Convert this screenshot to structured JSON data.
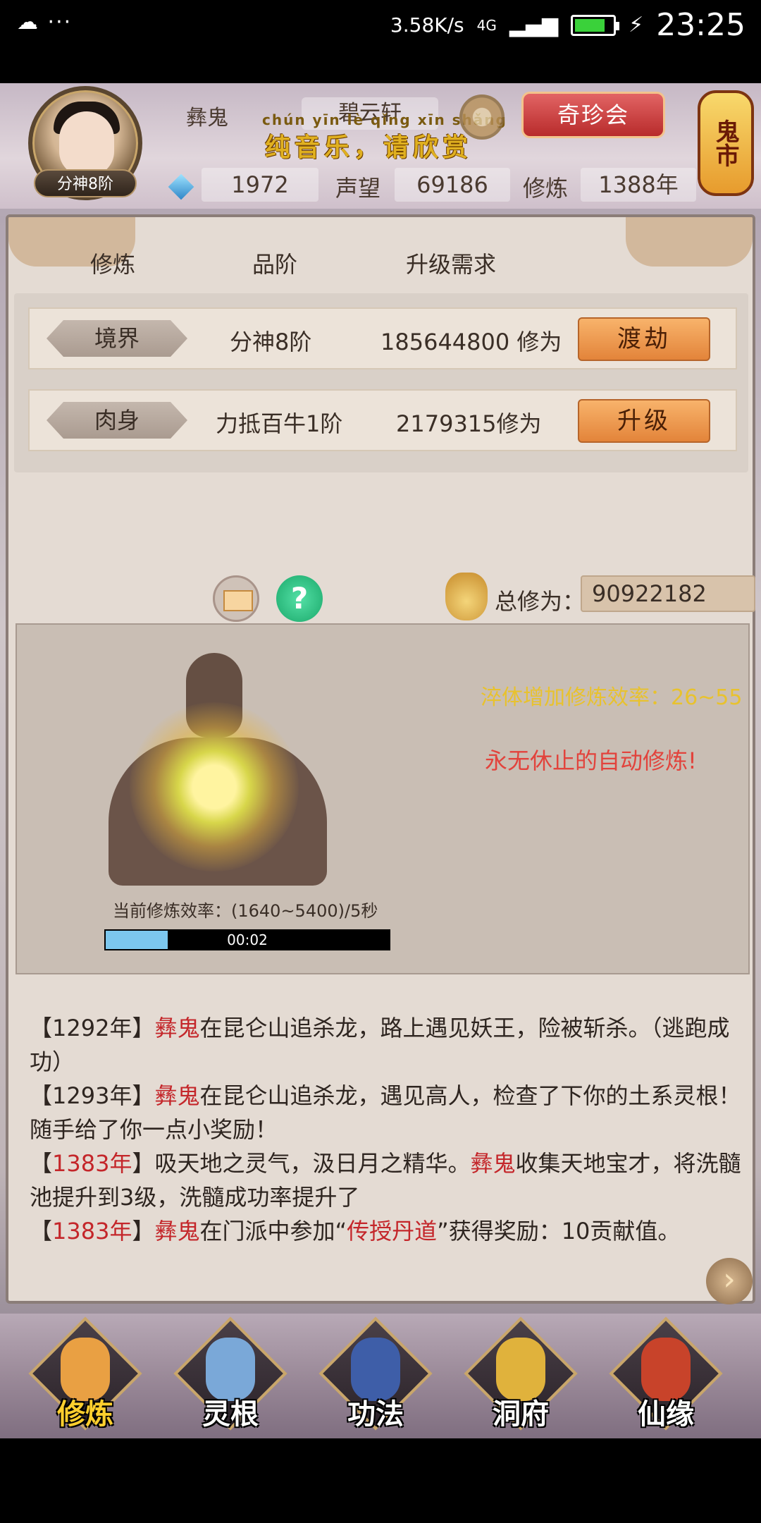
{
  "statusbar": {
    "left": "☁ ···",
    "speed": "3.58K/s",
    "network": "4G",
    "time": "23:25"
  },
  "header": {
    "realm_badge": "分神8阶",
    "player_name": "彝鬼",
    "sect": "碧云轩",
    "music_pinyin": "chún yīn lè  qǐng xīn shǎng",
    "music_text": "纯音乐，请欣赏",
    "treasure_button": "奇珍会",
    "ghost_market": "鬼市",
    "gems": "1972",
    "reputation_label": "声望",
    "reputation": "69186",
    "cultivation_label": "修炼",
    "cultivation_years": "1388年"
  },
  "panel": {
    "columns": [
      "修炼",
      "品阶",
      "升级需求"
    ],
    "rows": [
      {
        "tag": "境界",
        "level": "分神8阶",
        "requirement": "185644800 修为",
        "button": "渡劫"
      },
      {
        "tag": "肉身",
        "level": "力抵百牛1阶",
        "requirement": "2179315修为",
        "button": "升级"
      }
    ],
    "total_label": "总修为：",
    "total_value": "90922182",
    "help_symbol": "?"
  },
  "meditation": {
    "efficiency_bonus": "淬体增加修炼效率：26~55",
    "auto_text": "永无休止的自动修炼!",
    "current_efficiency": "当前修炼效率：(1640~5400)/5秒",
    "timer": "00:02",
    "progress": 0.22
  },
  "log": [
    {
      "year": "1292年",
      "year_red": false,
      "parts": [
        {
          "t": "彝鬼",
          "red": true
        },
        {
          "t": "在昆仑山追杀龙，路上遇见妖王，险被斩杀。（逃跑成功）",
          "red": false
        }
      ]
    },
    {
      "year": "1293年",
      "year_red": false,
      "parts": [
        {
          "t": "彝鬼",
          "red": true
        },
        {
          "t": "在昆仑山追杀龙，遇见高人，检查了下你的土系灵根！随手给了你一点小奖励！",
          "red": false
        }
      ]
    },
    {
      "year": "1383年",
      "year_red": true,
      "parts": [
        {
          "t": "吸天地之灵气，汲日月之精华。",
          "red": false
        },
        {
          "t": "彝鬼",
          "red": true
        },
        {
          "t": "收集天地宝才，将洗髓池提升到3级，洗髓成功率提升了",
          "red": false
        }
      ]
    },
    {
      "year": "1383年",
      "year_red": true,
      "parts": [
        {
          "t": "彝鬼",
          "red": true
        },
        {
          "t": "在门派中参加“",
          "red": false
        },
        {
          "t": "传授丹道",
          "red": true
        },
        {
          "t": "”获得奖励：10贡献值。",
          "red": false
        }
      ]
    }
  ],
  "nav": [
    {
      "label": "修炼",
      "icon": "monk-icon",
      "active": true
    },
    {
      "label": "灵根",
      "icon": "sword-icon",
      "active": false
    },
    {
      "label": "功法",
      "icon": "book-icon",
      "active": false
    },
    {
      "label": "洞府",
      "icon": "pavilion-icon",
      "active": false
    },
    {
      "label": "仙缘",
      "icon": "gourd-icon",
      "active": false
    }
  ]
}
